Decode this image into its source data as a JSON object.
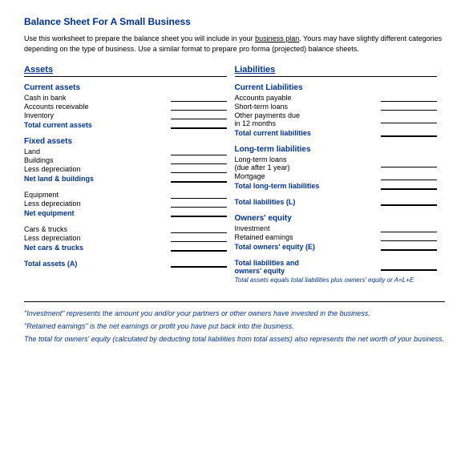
{
  "title": "Balance Sheet For A Small Business",
  "intro": "Use this worksheet to prepare the balance sheet you will include in your business plan.  Yours may have slightly different categories depending on the type of business.  Use a similar format to prepare pro forma (projected) balance sheets.",
  "assets_header": "Assets",
  "liabilities_header": "Liabilities",
  "assets": {
    "current_assets_title": "Current assets",
    "current_items": [
      "Cash in bank",
      "Accounts receivable",
      "Inventory"
    ],
    "total_current": "Total current assets",
    "fixed_assets_title": "Fixed assets",
    "fixed_items": [
      "Land",
      "Buildings",
      "Less depreciation"
    ],
    "net_land": "Net land & buildings",
    "equipment_items": [
      "Equipment",
      "Less depreciation"
    ],
    "net_equipment": "Net equipment",
    "cars_items": [
      "Cars & trucks",
      "Less depreciation"
    ],
    "net_cars": "Net cars & trucks",
    "total_assets": "Total assets (A)"
  },
  "liabilities": {
    "current_liabilities_title": "Current Liabilities",
    "current_items": [
      "Accounts payable",
      "Short-term loans",
      "Other payments due in 12 months"
    ],
    "total_current": "Total current liabilities",
    "longterm_title": "Long-term liabilities",
    "longterm_items": [
      "Long-term loans (due after 1 year)",
      "Mortgage"
    ],
    "total_longterm": "Total long-term liabilities",
    "total_liabilities": "Total liabilities (L)",
    "equity_title": "Owners' equity",
    "equity_items": [
      "Investment",
      "Retained earnings"
    ],
    "total_equity": "Total owners' equity (E)",
    "total_liab_equity_line1": "Total liabilities and",
    "total_liab_equity_line2": "owners' equity",
    "total_liab_equity_sub": "Total assets equals total liabilities plus owners' equity or A=L+E"
  },
  "footnotes": [
    "\"Investment\" represents the amount you and/or your partners or other owners have invested in the business.",
    "\"Retained earnings\" is the net earnings or profit you have put back into the business.",
    "The total for owners' equity (calculated by deducting total liabilities from total assets) also represents the net worth of your business."
  ]
}
